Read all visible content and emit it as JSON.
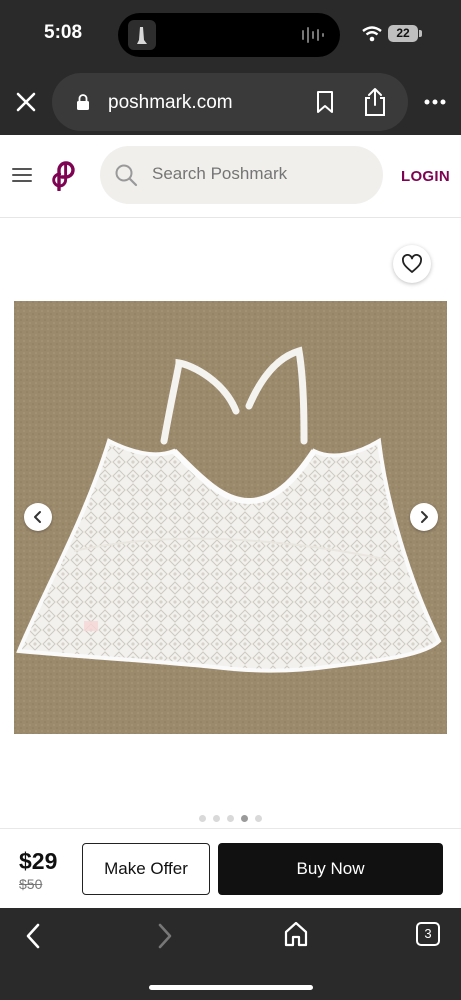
{
  "status": {
    "time": "5:08",
    "battery": "22"
  },
  "browser": {
    "url": "poshmark.com",
    "open_tabs": "3"
  },
  "header": {
    "search_placeholder": "Search Poshmark",
    "login_label": "LOGIN"
  },
  "listing": {
    "carousel": {
      "total_images": 5,
      "current_index": 4
    }
  },
  "buy_bar": {
    "price": "$29",
    "original_price": "$50",
    "offer_label": "Make Offer",
    "buy_label": "Buy Now"
  },
  "colors": {
    "brand": "#7f0353",
    "chrome": "#2a2a2a",
    "carpet": "#9c8a6c"
  },
  "icons": [
    "close-icon",
    "lock-icon",
    "bookmark-icon",
    "share-icon",
    "more-icon",
    "menu-icon",
    "poshmark-logo-icon",
    "search-icon",
    "heart-icon",
    "chevron-left-icon",
    "chevron-right-icon",
    "back-icon",
    "forward-icon",
    "home-icon",
    "tabs-icon"
  ]
}
